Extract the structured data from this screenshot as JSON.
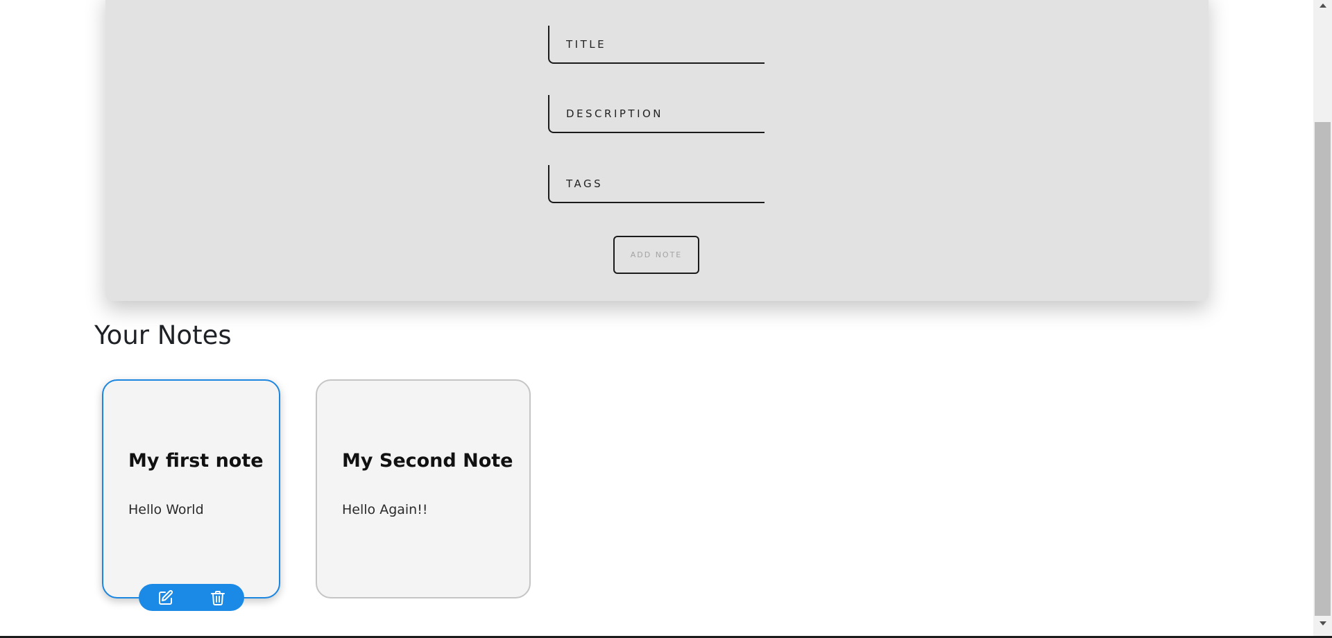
{
  "form": {
    "title_placeholder": "TITLE",
    "description_placeholder": "DESCRIPTION",
    "tags_placeholder": "TAGS",
    "add_button_label": "ADD NOTE"
  },
  "notes_section": {
    "heading": "Your Notes",
    "notes": [
      {
        "title": "My first note",
        "description": "Hello World"
      },
      {
        "title": "My Second Note",
        "description": "Hello Again!!"
      }
    ],
    "actions": {
      "edit_icon": "edit-icon",
      "delete_icon": "trash-icon"
    }
  },
  "colors": {
    "accent": "#1a8ae6",
    "form_background": "#e2e2e2",
    "card_background": "#f4f4f4"
  }
}
